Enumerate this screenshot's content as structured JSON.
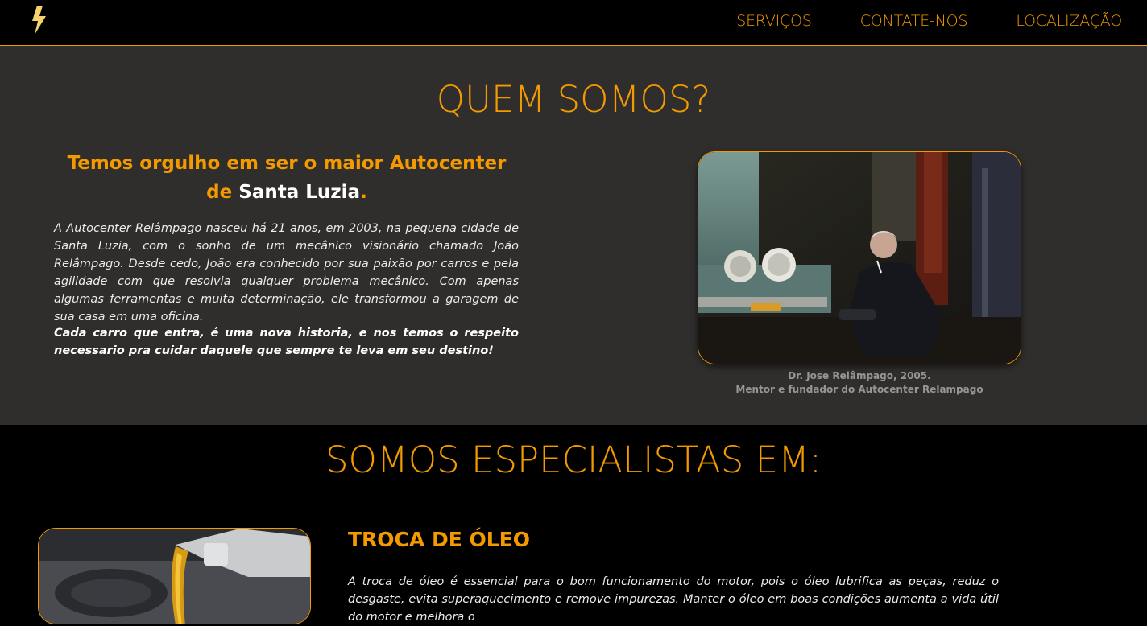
{
  "colors": {
    "accent": "#f29a00",
    "about_bg": "#302e2c",
    "page_bg": "#000000"
  },
  "header": {
    "logo_icon": "lightning-bolt-icon",
    "nav": [
      {
        "label": "SERVIÇOS"
      },
      {
        "label": "CONTATE-NOS"
      },
      {
        "label": "LOCALIZAÇÃO"
      }
    ]
  },
  "about": {
    "title": "QUEM SOMOS?",
    "subtitle_part1": "Temos orgulho em ser o maior Autocenter de ",
    "subtitle_highlight": "Santa Luzia",
    "subtitle_part2": ".",
    "paragraph1": "A Autocenter Relâmpago nasceu há 21 anos, em 2003, na pequena cidade de Santa Luzia, com o sonho de um mecânico visionário chamado João Relâmpago. Desde cedo, João era conhecido por sua paixão por carros e pela agilidade com que resolvia qualquer problema mecânico. Com apenas algumas ferramentas e muita determinação, ele transformou a garagem de sua casa em uma oficina.",
    "paragraph2": "Cada carro que entra, é uma nova historia, e nos temos o respeito necessario pra cuidar daquele que sempre te leva em seu destino!",
    "caption_line1": "Dr. Jose Relâmpago, 2005.",
    "caption_line2": "Mentor e fundador do Autocenter Relampago"
  },
  "specialists": {
    "title": "SOMOS ESPECIALISTAS EM:",
    "services": [
      {
        "title": "TROCA DE ÓLEO",
        "description": "A troca de óleo é essencial para o bom funcionamento do motor, pois o óleo lubrifica as peças, reduz o desgaste, evita superaquecimento e remove impurezas. Manter o óleo em boas condições aumenta a vida útil do motor e melhora o"
      }
    ]
  }
}
